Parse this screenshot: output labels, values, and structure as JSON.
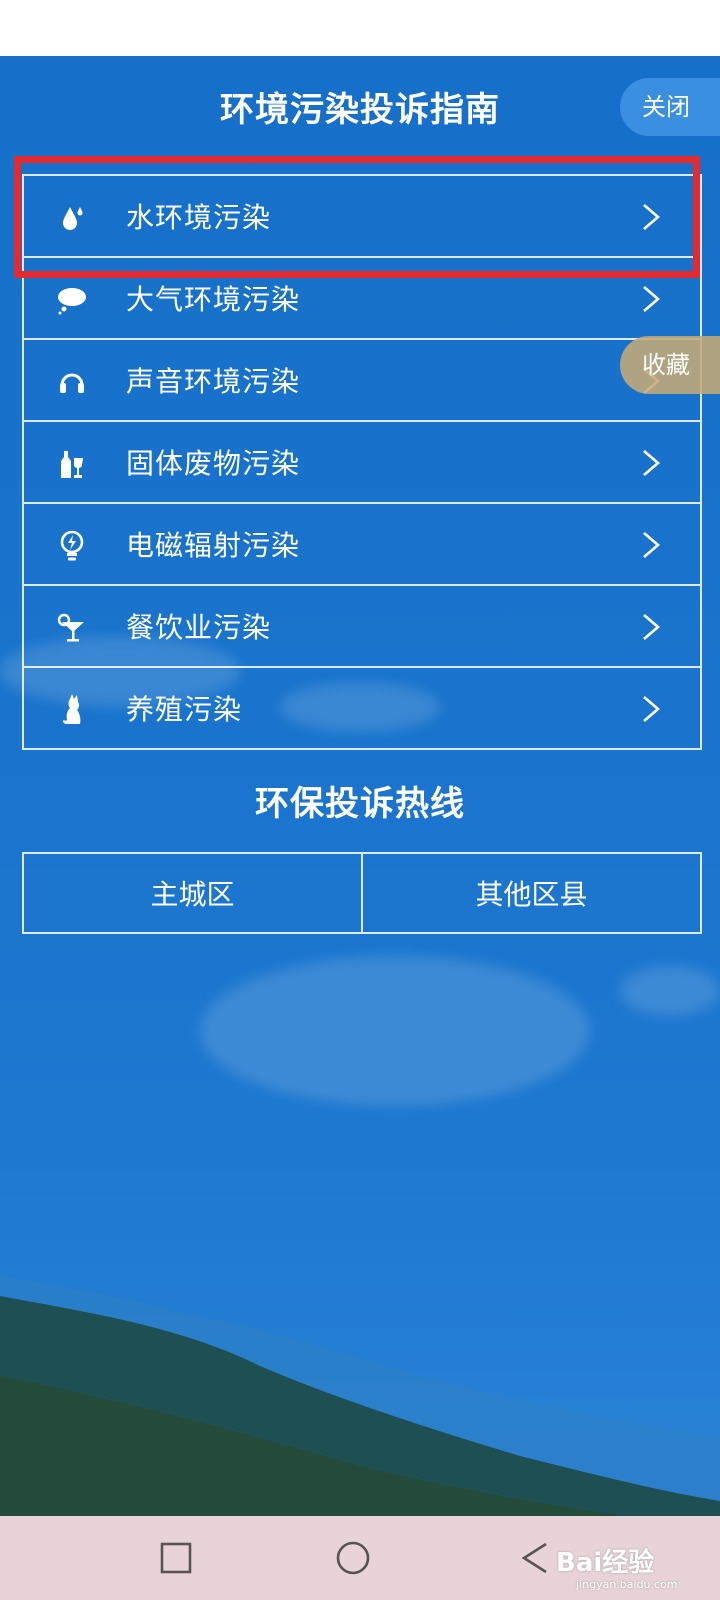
{
  "header": {
    "title": "环境污染投诉指南",
    "close_label": "关闭"
  },
  "favorite_label": "收藏",
  "guide_items": [
    {
      "label": "水环境污染",
      "icon": "water-drop-icon"
    },
    {
      "label": "大气环境污染",
      "icon": "cloud-icon"
    },
    {
      "label": "声音环境污染",
      "icon": "headphones-icon"
    },
    {
      "label": "固体废物污染",
      "icon": "bottles-icon"
    },
    {
      "label": "电磁辐射污染",
      "icon": "lightbulb-icon"
    },
    {
      "label": "餐饮业污染",
      "icon": "cocktail-icon"
    },
    {
      "label": "养殖污染",
      "icon": "cat-icon"
    }
  ],
  "hotline": {
    "title": "环保投诉热线",
    "options": [
      "主城区",
      "其他区县"
    ]
  },
  "watermark": {
    "brand": "Bai经验",
    "url": "jingyan.baidu.com"
  },
  "colors": {
    "background": "#1670c9",
    "highlight": "#e32a2f",
    "close_button": "#3a8fe0",
    "favorite_button": "#c4aa78",
    "nav_bar": "#e8d3d8"
  }
}
